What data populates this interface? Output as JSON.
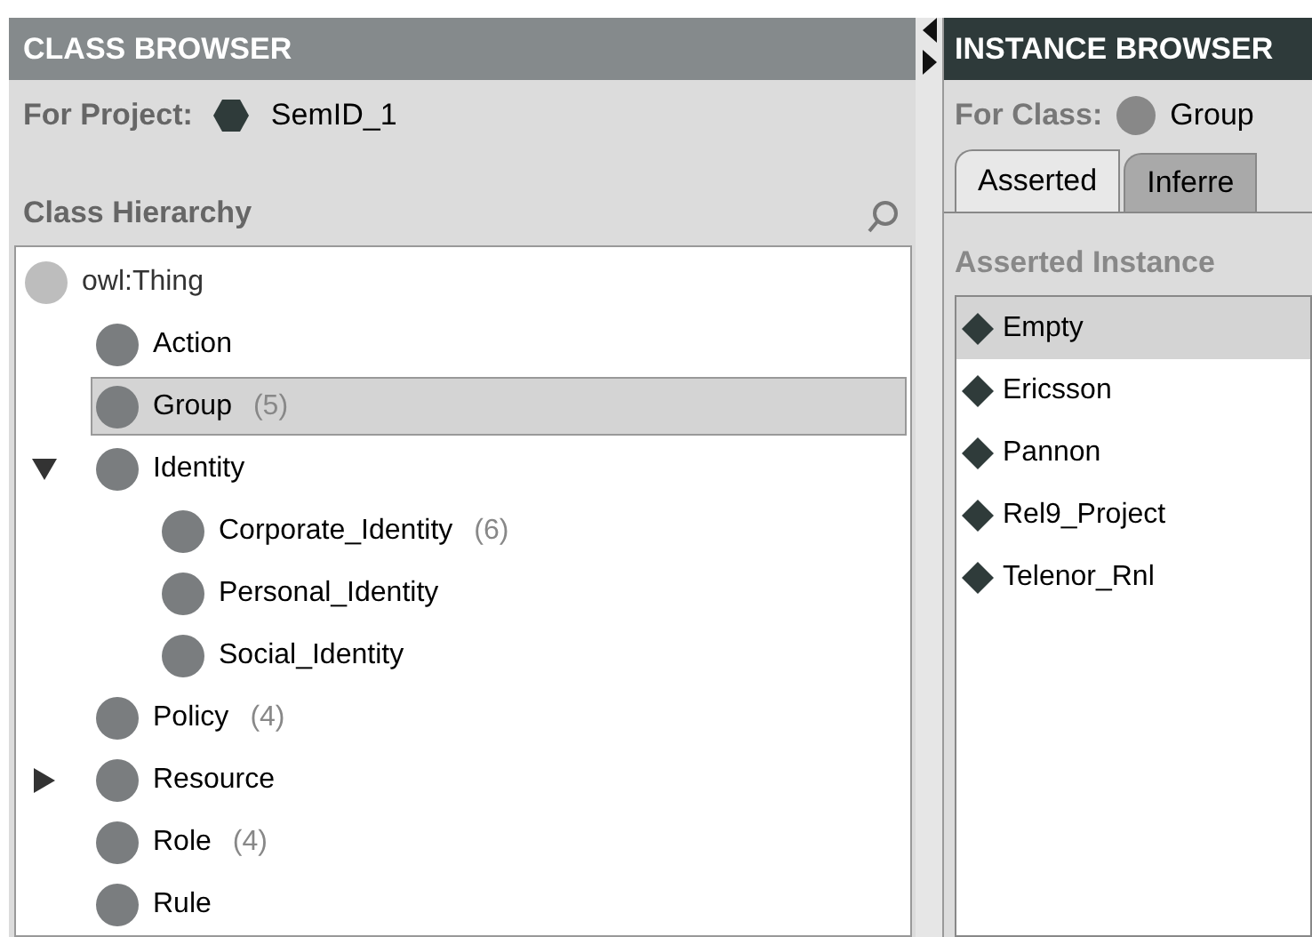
{
  "class_browser": {
    "title": "CLASS BROWSER",
    "project_label": "For Project:",
    "project_name": "SemID_1",
    "hierarchy_label": "Class Hierarchy",
    "tree": [
      {
        "label": "owl:Thing",
        "kind": "root",
        "selected": false,
        "children": [
          {
            "label": "Action",
            "kind": "leaf",
            "selected": false
          },
          {
            "label": "Group",
            "count": "(5)",
            "kind": "leaf",
            "selected": true
          },
          {
            "label": "Identity",
            "kind": "branch",
            "expanded": true,
            "selected": false,
            "children": [
              {
                "label": "Corporate_Identity",
                "count": "(6)",
                "kind": "leaf",
                "selected": false
              },
              {
                "label": "Personal_Identity",
                "kind": "leaf",
                "selected": false
              },
              {
                "label": "Social_Identity",
                "kind": "leaf",
                "selected": false
              }
            ]
          },
          {
            "label": "Policy",
            "count": "(4)",
            "kind": "leaf",
            "selected": false
          },
          {
            "label": "Resource",
            "kind": "branch",
            "expanded": false,
            "selected": false
          },
          {
            "label": "Role",
            "count": "(4)",
            "kind": "leaf",
            "selected": false
          },
          {
            "label": "Rule",
            "kind": "leaf",
            "selected": false
          }
        ]
      }
    ]
  },
  "instance_browser": {
    "title": "INSTANCE BROWSER",
    "class_label": "For Class:",
    "class_name": "Group",
    "tabs": [
      {
        "label": "Asserted",
        "selected": true
      },
      {
        "label": "Inferre",
        "selected": false
      }
    ],
    "list_label": "Asserted Instance",
    "instances": [
      {
        "label": "Empty",
        "selected": true
      },
      {
        "label": "Ericsson",
        "selected": false
      },
      {
        "label": "Pannon",
        "selected": false
      },
      {
        "label": "Rel9_Project",
        "selected": false
      },
      {
        "label": "Telenor_Rnl",
        "selected": false
      }
    ]
  }
}
